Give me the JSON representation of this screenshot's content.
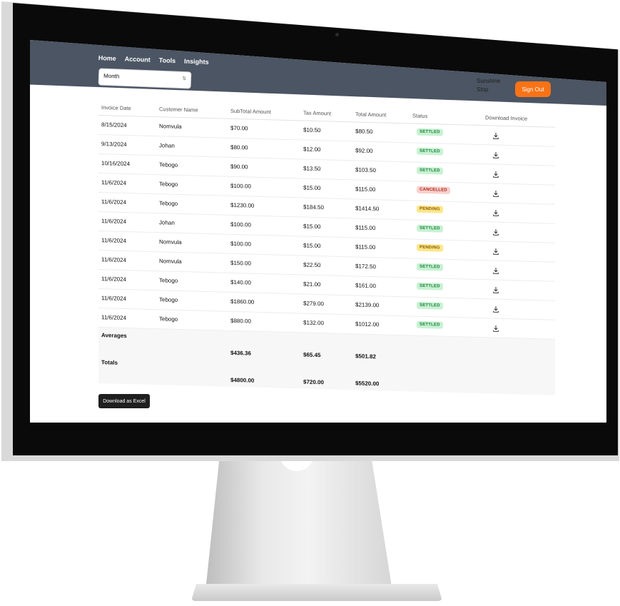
{
  "nav": {
    "items": [
      "Home",
      "Account",
      "Tools",
      "Insights"
    ]
  },
  "filter": {
    "selected": "Month"
  },
  "user": {
    "name_line1": "Sunshine",
    "name_line2": "Stop"
  },
  "actions": {
    "sign_out": "Sign Out",
    "download_excel": "Download as Excel"
  },
  "table": {
    "headers": [
      "Invoice Date",
      "Customer Name",
      "SubTotal Amount",
      "Tax Amount",
      "Total Amount",
      "Status",
      "Download Invoice"
    ],
    "rows": [
      {
        "date": "8/15/2024",
        "customer": "Nomvula",
        "subtotal": "$70.00",
        "tax": "$10.50",
        "total": "$80.50",
        "status": "SETTLED"
      },
      {
        "date": "9/13/2024",
        "customer": "Johan",
        "subtotal": "$80.00",
        "tax": "$12.00",
        "total": "$92.00",
        "status": "SETTLED"
      },
      {
        "date": "10/16/2024",
        "customer": "Tebogo",
        "subtotal": "$90.00",
        "tax": "$13.50",
        "total": "$103.50",
        "status": "SETTLED"
      },
      {
        "date": "11/6/2024",
        "customer": "Tebogo",
        "subtotal": "$100.00",
        "tax": "$15.00",
        "total": "$115.00",
        "status": "CANCELLED"
      },
      {
        "date": "11/6/2024",
        "customer": "Tebogo",
        "subtotal": "$1230.00",
        "tax": "$184.50",
        "total": "$1414.50",
        "status": "PENDING"
      },
      {
        "date": "11/6/2024",
        "customer": "Johan",
        "subtotal": "$100.00",
        "tax": "$15.00",
        "total": "$115.00",
        "status": "SETTLED"
      },
      {
        "date": "11/6/2024",
        "customer": "Nomvula",
        "subtotal": "$100.00",
        "tax": "$15.00",
        "total": "$115.00",
        "status": "PENDING"
      },
      {
        "date": "11/6/2024",
        "customer": "Nomvula",
        "subtotal": "$150.00",
        "tax": "$22.50",
        "total": "$172.50",
        "status": "SETTLED"
      },
      {
        "date": "11/6/2024",
        "customer": "Tebogo",
        "subtotal": "$140.00",
        "tax": "$21.00",
        "total": "$161.00",
        "status": "SETTLED"
      },
      {
        "date": "11/6/2024",
        "customer": "Tebogo",
        "subtotal": "$1860.00",
        "tax": "$279.00",
        "total": "$2139.00",
        "status": "SETTLED"
      },
      {
        "date": "11/6/2024",
        "customer": "Tebogo",
        "subtotal": "$880.00",
        "tax": "$132.00",
        "total": "$1012.00",
        "status": "SETTLED"
      }
    ],
    "averages_label": "Averages",
    "averages": {
      "subtotal": "$436.36",
      "tax": "$65.45",
      "total": "$501.82"
    },
    "totals_label": "Totals",
    "totals": {
      "subtotal": "$4800.00",
      "tax": "$720.00",
      "total": "$5520.00"
    }
  },
  "colors": {
    "navbar": "#4b5563",
    "accent": "#f97316",
    "settled": "#c8f2d3",
    "cancelled": "#f8d0cc",
    "pending": "#fde68a"
  },
  "icons": {
    "download": "download-icon",
    "select_caret": "chevron-updown-icon"
  }
}
